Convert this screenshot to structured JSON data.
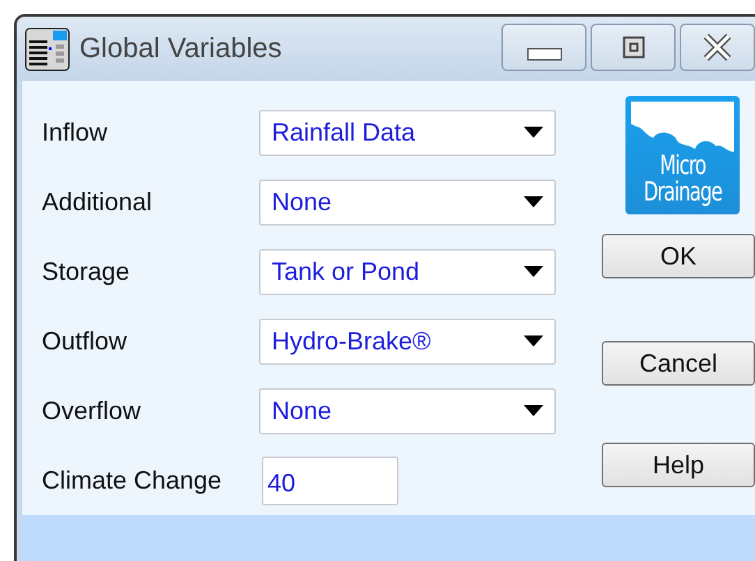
{
  "window": {
    "title": "Global Variables"
  },
  "fields": [
    {
      "label": "Inflow",
      "value": "Rainfall Data",
      "kind": "dropdown"
    },
    {
      "label": "Additional",
      "value": "None",
      "kind": "dropdown"
    },
    {
      "label": "Storage",
      "value": "Tank or Pond",
      "kind": "dropdown"
    },
    {
      "label": "Outflow",
      "value": "Hydro-Brake®",
      "kind": "dropdown"
    },
    {
      "label": "Overflow",
      "value": "None",
      "kind": "dropdown"
    },
    {
      "label": "Climate Change",
      "value": "40",
      "kind": "textbox"
    }
  ],
  "logo": {
    "lines": [
      "Micro",
      "Drainage"
    ]
  },
  "buttons": [
    "OK",
    "Cancel",
    "Help"
  ]
}
